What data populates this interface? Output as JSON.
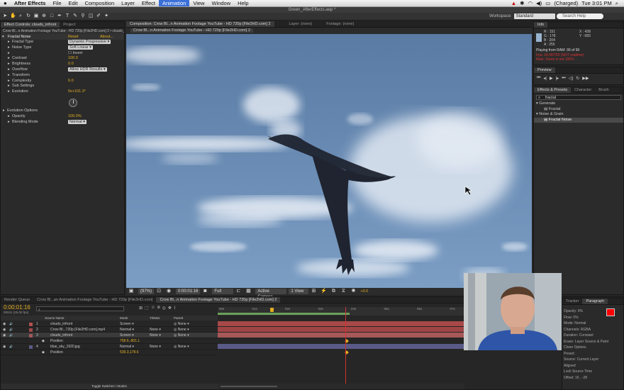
{
  "menubar": {
    "apple": "",
    "app": "After Effects",
    "items": [
      "File",
      "Edit",
      "Composition",
      "Layer",
      "Effect",
      "Animation",
      "View",
      "Window",
      "Help"
    ],
    "active": "Animation",
    "battery": "(Charged)",
    "clock": "Tue 3:01 PM"
  },
  "window_title": "Green_AfterEffects.aep *",
  "toolbar": {
    "workspace_label": "Workspace:",
    "workspace_value": "Standard",
    "search_placeholder": "Search Help"
  },
  "effect_controls": {
    "tab_label": "Effect Controls: clouds_infront",
    "project_tab": "Project",
    "subtitle": "Crow Bl...n Animation Footage YouTube - HD 720p [File2HD.com] 2 • clouds_infront",
    "effect_name": "Fractal Noise",
    "reset": "Reset",
    "about": "About...",
    "rows": [
      {
        "label": "Fractal Type",
        "value": "Dynamic Progressive",
        "kind": "dd",
        "indent": 1
      },
      {
        "label": "Noise Type",
        "value": "Soft Linear",
        "kind": "dd",
        "indent": 1
      },
      {
        "label": "",
        "value": "Invert",
        "kind": "check",
        "indent": 1
      },
      {
        "label": "Contrast",
        "value": "100.0",
        "kind": "num",
        "indent": 1
      },
      {
        "label": "Brightness",
        "value": "0.0",
        "kind": "num",
        "indent": 1
      },
      {
        "label": "Overflow",
        "value": "Allow HDR Results",
        "kind": "dd",
        "indent": 1
      },
      {
        "label": "Transform",
        "value": "",
        "kind": "group",
        "indent": 1
      },
      {
        "label": "Complexity",
        "value": "6.0",
        "kind": "num",
        "indent": 1
      },
      {
        "label": "Sub Settings",
        "value": "",
        "kind": "group",
        "indent": 1
      },
      {
        "label": "Evolution",
        "value": "0x+101.3°",
        "kind": "num",
        "indent": 1
      }
    ],
    "rows2": [
      {
        "label": "Evolution Options",
        "value": "",
        "kind": "group",
        "indent": 0
      },
      {
        "label": "Opacity",
        "value": "100.0%",
        "kind": "num",
        "indent": 1
      },
      {
        "label": "Blending Mode",
        "value": "Normal",
        "kind": "dd",
        "indent": 1
      }
    ]
  },
  "composition": {
    "tab_label": "Composition: Crow Bl...n Animation Footage YouTube - HD 720p [File2HD.com] 2",
    "layer_tab": "Layer: (none)",
    "footage_tab": "Footage: (none)",
    "sub_tab": "Crow Bl...n Animation Footage YouTube - HD 720p [File2HD.com] 2",
    "footer": {
      "zoom": "(97%)",
      "timecode": "0:00:01:16",
      "resolution": "Full",
      "camera": "Active Camera",
      "views": "1 View",
      "exposure": "+0.0"
    }
  },
  "info": {
    "tab": "Info",
    "r": "R : 151",
    "g": "G : 178",
    "b": "B : 204",
    "a": "A : 255",
    "x": "X : 438",
    "y": "Y : 683",
    "playing": "Playing from RAM: 99 of 99",
    "fps": "Fps: 24.997/25 (NOT realtime)",
    "note": "Note: Zoom is not 100%",
    "swatch": "#97b2cc"
  },
  "preview": {
    "tab": "Preview"
  },
  "effects_presets": {
    "tab": "Effects & Presets",
    "character_tab": "Character",
    "brush_tab": "Brush",
    "search": "fractal",
    "tree": [
      {
        "label": "Generate",
        "type": "folder"
      },
      {
        "label": "Fractal",
        "type": "item"
      },
      {
        "label": "Noise & Grain",
        "type": "folder"
      },
      {
        "label": "Fractal Noise",
        "type": "item",
        "selected": true
      }
    ]
  },
  "timeline": {
    "render_queue_tab": "Render Queue",
    "tab2": "Crow Bl...an Animation Footage YouTube - HD 720p [File2HD.com]",
    "tab3": "Crow Bl...n Animation Footage YouTube - HD 720p [File2HD.com] 2",
    "current_time": "0:00:01:16",
    "frame_info": "00041 (25.00 fps)",
    "col_source": "Source Name",
    "col_mode": "Mode",
    "col_trkmat": "TrkMat",
    "col_parent": "Parent",
    "ruler": [
      "00s",
      "01s",
      "02s",
      "03s",
      "04s",
      "05s",
      "06s",
      "07s"
    ],
    "layers": [
      {
        "num": "1",
        "name": "clouds_infront",
        "mode": "Screen",
        "trkmat": "",
        "parent": "None",
        "color": "#b05050"
      },
      {
        "num": "2",
        "name": "Crow Bl...720p [File2HD.com].mp4",
        "mode": "Normal",
        "trkmat": "None",
        "parent": "None",
        "color": "#a04a4a"
      },
      {
        "num": "3",
        "name": "clouds_infront",
        "mode": "Screen",
        "trkmat": "None",
        "parent": "None",
        "color": "#a05a5a",
        "selected": true
      },
      {
        "num": "",
        "name": "Position",
        "mode": "758.6,-801.1",
        "trkmat": "",
        "parent": "",
        "color": ""
      },
      {
        "num": "4",
        "name": "blue_sky_1920.jpg",
        "mode": "Normal",
        "trkmat": "None",
        "parent": "None",
        "color": "#5a5a84"
      },
      {
        "num": "",
        "name": "Position",
        "mode": "539.3,178.6",
        "trkmat": "",
        "parent": "",
        "color": ""
      }
    ],
    "footer_label": "Toggle Switches / Modes"
  },
  "right_lower": {
    "tab1": "Tracker",
    "tab2": "Paragraph",
    "opacity_label": "Opacity: 0%",
    "flow_label": "Flow: 0%",
    "mode_label": "Mode: Normal",
    "channels_label": "Channels: RGBA",
    "duration_label": "Duration: Constant",
    "erase_label": "Erase: Layer Source & Paint",
    "clone_options": "Clone Options",
    "preset_label": "Preset:",
    "source_label": "Source: Current Layer",
    "aligned_label": "Aligned",
    "lock_label": "Lock Source Time",
    "offset_label": "Offset: 16 , -28",
    "swatch_fg": "#ff0000"
  }
}
